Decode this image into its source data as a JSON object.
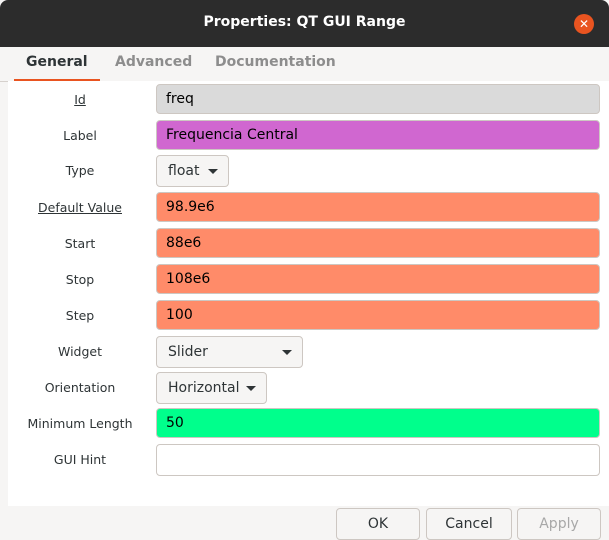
{
  "window": {
    "title": "Properties: QT GUI Range",
    "close_icon": "close-icon"
  },
  "tabs": [
    {
      "label": "General",
      "active": true
    },
    {
      "label": "Advanced",
      "active": false
    },
    {
      "label": "Documentation",
      "active": false
    }
  ],
  "fields": {
    "id": {
      "label": "Id",
      "value": "freq",
      "color": "#dadada"
    },
    "label": {
      "label": "Label",
      "value": "Frequencia Central",
      "color": "#d067d0"
    },
    "type": {
      "label": "Type",
      "value": "float"
    },
    "default_value": {
      "label": "Default Value",
      "value": "98.9e6",
      "color": "#ff8b69"
    },
    "start": {
      "label": "Start",
      "value": "88e6",
      "color": "#ff8b69"
    },
    "stop": {
      "label": "Stop",
      "value": "108e6",
      "color": "#ff8b69"
    },
    "step": {
      "label": "Step",
      "value": "100",
      "color": "#ff8b69"
    },
    "widget": {
      "label": "Widget",
      "value": "Slider"
    },
    "orientation": {
      "label": "Orientation",
      "value": "Horizontal"
    },
    "minimum_length": {
      "label": "Minimum Length",
      "value": "50",
      "color": "#00ff8c"
    },
    "gui_hint": {
      "label": "GUI Hint",
      "value": "",
      "color": "#ffffff"
    }
  },
  "buttons": {
    "ok": "OK",
    "cancel": "Cancel",
    "apply": "Apply"
  },
  "theme": {
    "accent": "#e95420",
    "titlebar": "#2c2c2c"
  }
}
